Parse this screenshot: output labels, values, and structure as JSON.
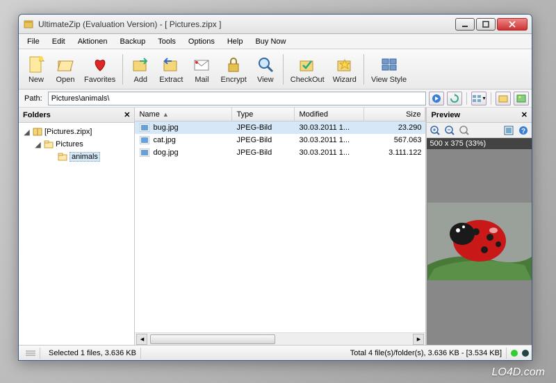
{
  "title": "UltimateZip (Evaluation Version) - [ Pictures.zipx ]",
  "menus": [
    "File",
    "Edit",
    "Aktionen",
    "Backup",
    "Tools",
    "Options",
    "Help",
    "Buy Now"
  ],
  "toolbar": [
    {
      "icon": "new",
      "label": "New"
    },
    {
      "icon": "open",
      "label": "Open"
    },
    {
      "icon": "fav",
      "label": "Favorites"
    },
    {
      "sep": true
    },
    {
      "icon": "add",
      "label": "Add"
    },
    {
      "icon": "extract",
      "label": "Extract"
    },
    {
      "icon": "mail",
      "label": "Mail"
    },
    {
      "icon": "encrypt",
      "label": "Encrypt"
    },
    {
      "icon": "view",
      "label": "View"
    },
    {
      "sep": true
    },
    {
      "icon": "checkout",
      "label": "CheckOut"
    },
    {
      "icon": "wizard",
      "label": "Wizard"
    },
    {
      "sep": true
    },
    {
      "icon": "viewstyle",
      "label": "View Style"
    }
  ],
  "path": {
    "label": "Path:",
    "value": "Pictures\\animals\\"
  },
  "folders": {
    "title": "Folders",
    "root": "[Pictures.zipx]",
    "items": [
      "Pictures",
      "animals"
    ]
  },
  "columns": {
    "name": "Name",
    "type": "Type",
    "modified": "Modified",
    "size": "Size"
  },
  "files": [
    {
      "name": "bug.jpg",
      "type": "JPEG-Bild",
      "modified": "30.03.2011 1...",
      "size": "23.290",
      "sel": true
    },
    {
      "name": "cat.jpg",
      "type": "JPEG-Bild",
      "modified": "30.03.2011 1...",
      "size": "567.063"
    },
    {
      "name": "dog.jpg",
      "type": "JPEG-Bild",
      "modified": "30.03.2011 1...",
      "size": "3.111.122"
    }
  ],
  "preview": {
    "title": "Preview",
    "dims": "500 x 375 (33%)"
  },
  "status": {
    "selected": "Selected 1 files, 3.636 KB",
    "total": "Total 4 file(s)/folder(s), 3.636 KB - [3.534 KB]"
  },
  "watermark": "LO4D.com"
}
